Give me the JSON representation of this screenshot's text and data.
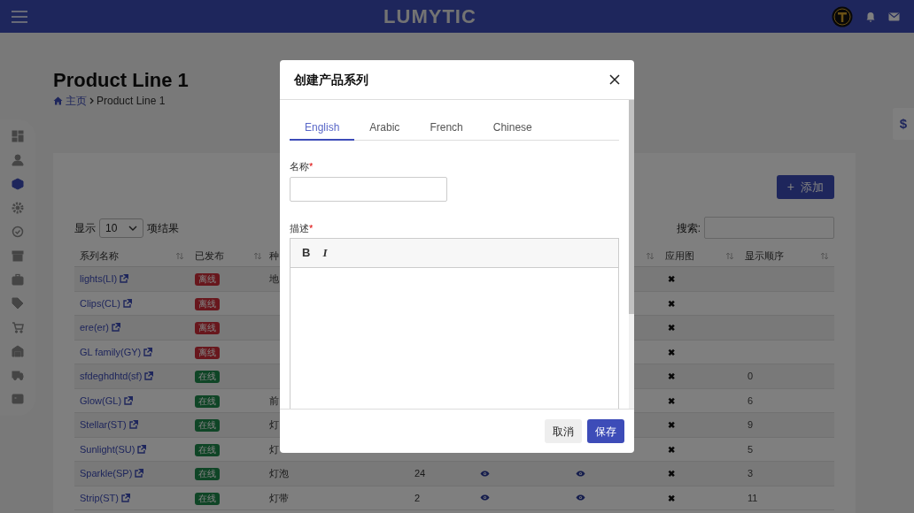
{
  "top_bar": {
    "logo": "LUMYTIC"
  },
  "side_tab": {
    "label": "$"
  },
  "sidebar": {
    "items": [
      {
        "selected": false
      },
      {
        "selected": false
      },
      {
        "selected": true
      },
      {
        "selected": false
      },
      {
        "selected": false
      },
      {
        "selected": false
      },
      {
        "selected": false
      },
      {
        "selected": false
      },
      {
        "selected": false
      },
      {
        "selected": false
      },
      {
        "selected": false
      },
      {
        "selected": false
      }
    ]
  },
  "page": {
    "title": "Product Line 1",
    "breadcrumb": [
      {
        "label": "主页",
        "link": true
      },
      {
        "label": "Product Line 1",
        "link": false
      }
    ]
  },
  "add_button": {
    "icon": "+",
    "label": "添加"
  },
  "length_menu": {
    "prefix": "显示",
    "value": "10",
    "suffix": "项结果"
  },
  "search": {
    "label": "搜索:"
  },
  "table": {
    "columns": [
      {
        "label": "系列名称",
        "sort_icon": true
      },
      {
        "label": "已发布",
        "sort_icon": true
      },
      {
        "label": "种"
      },
      {},
      {},
      {
        "sort_icon": true
      },
      {
        "label": "应用图",
        "sort_icon": true
      },
      {
        "label": "显示顺序",
        "sort_icon": true
      }
    ],
    "rows": [
      {
        "name": "lights(LI)",
        "status": {
          "label": "离线",
          "online": false
        },
        "type": "地",
        "applied": "✖"
      },
      {
        "name": "Clips(CL)",
        "status": {
          "label": "离线",
          "online": false
        },
        "applied": "✖"
      },
      {
        "name": "ere(er)",
        "status": {
          "label": "离线",
          "online": false
        },
        "applied": "✖"
      },
      {
        "name": "GL family(GY)",
        "status": {
          "label": "离线",
          "online": false
        },
        "applied": "✖"
      },
      {
        "name": "sfdeghdhtd(sf)",
        "status": {
          "label": "在线",
          "online": true
        },
        "applied": "✖",
        "order": "0"
      },
      {
        "name": "Glow(GL)",
        "status": {
          "label": "在线",
          "online": true
        },
        "type": "前",
        "applied": "✖",
        "order": "6"
      },
      {
        "name": "Stellar(ST)",
        "status": {
          "label": "在线",
          "online": true
        },
        "type": "灯",
        "applied": "✖",
        "order": "9"
      },
      {
        "name": "Sunlight(SU)",
        "status": {
          "label": "在线",
          "online": true
        },
        "type": "灯",
        "applied": "✖",
        "order": "5"
      },
      {
        "name": "Sparkle(SP)",
        "status": {
          "label": "在线",
          "online": true
        },
        "type": "灯泡",
        "count": "24",
        "eye_a": true,
        "eye_b": true,
        "applied": "✖",
        "order": "3"
      },
      {
        "name": "Strip(ST)",
        "status": {
          "label": "在线",
          "online": true
        },
        "type": "灯带",
        "count": "2",
        "eye_a": true,
        "eye_b": true,
        "applied": "✖",
        "order": "11"
      }
    ]
  },
  "modal": {
    "title": "创建产品系列",
    "tabs": [
      {
        "label": "English",
        "selected": true
      },
      {
        "label": "Arabic",
        "selected": false
      },
      {
        "label": "French",
        "selected": false
      },
      {
        "label": "Chinese",
        "selected": false
      }
    ],
    "required_mark": "*",
    "name_field": {
      "label": "名称",
      "required": true
    },
    "description_field": {
      "label": "描述",
      "required": true,
      "toolbar": [
        "B",
        "I"
      ]
    },
    "buttons": {
      "cancel": "取消",
      "save": "保存"
    }
  }
}
